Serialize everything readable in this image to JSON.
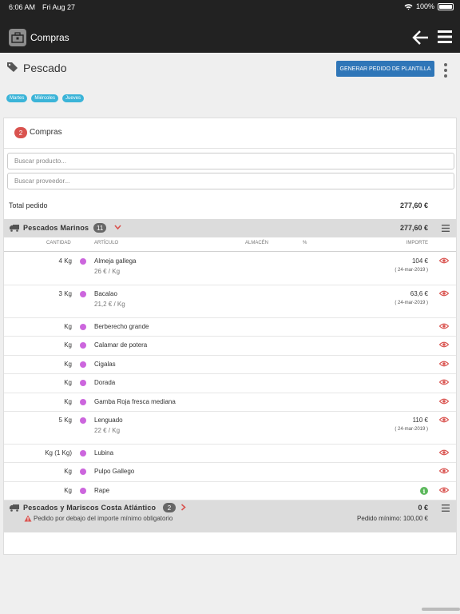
{
  "status_bar": {
    "time": "6:06 AM",
    "date": "Fri Aug 27",
    "battery": "100%"
  },
  "navbar": {
    "title": "Compras"
  },
  "header": {
    "title": "Pescado",
    "generate_button": "GENERAR PEDIDO DE PLANTILLA",
    "days": [
      "Martes",
      "Miércoles",
      "Jueves"
    ]
  },
  "card": {
    "count": "2",
    "title": "Compras",
    "search_product_placeholder": "Buscar producto...",
    "search_supplier_placeholder": "Buscar proveedor...",
    "total_label": "Total pedido",
    "total_value": "277,60 €"
  },
  "group1": {
    "name": "Pescados Marinos",
    "count": "11",
    "total": "277,60 €"
  },
  "columns": {
    "cantidad": "CANTIDAD",
    "articulo": "ARTÍCULO",
    "almacen": "ALMACÉN",
    "pct": "%",
    "importe": "IMPORTE"
  },
  "items": [
    {
      "qty": "4 Kg",
      "name": "Almeja gallega",
      "price": "26 € / Kg",
      "amount": "104 €",
      "date": "( 24-mar-2019 )"
    },
    {
      "qty": "3 Kg",
      "name": "Bacalao",
      "price": "21,2 € / Kg",
      "amount": "63,6 €",
      "date": "( 24-mar-2019 )"
    },
    {
      "qty": "Kg",
      "name": "Berberecho grande"
    },
    {
      "qty": "Kg",
      "name": "Calamar de potera"
    },
    {
      "qty": "Kg",
      "name": "Cigalas"
    },
    {
      "qty": "Kg",
      "name": "Dorada"
    },
    {
      "qty": "Kg",
      "name": "Gamba Roja fresca mediana"
    },
    {
      "qty": "5 Kg",
      "name": "Lenguado",
      "price": "22 € / Kg",
      "amount": "110 €",
      "date": "( 24-mar-2019 )"
    },
    {
      "qty": "Kg (1 Kg)",
      "name": "Lubina"
    },
    {
      "qty": "Kg",
      "name": "Pulpo Gallego"
    },
    {
      "qty": "Kg",
      "name": "Rape",
      "info": "i"
    }
  ],
  "group2": {
    "name": "Pescados y Mariscos Costa Atlántico",
    "count": "2",
    "total": "0 €",
    "warning": "Pedido por debajo del importe mínimo obligatorio",
    "min_order": "Pedido mínimo: 100,00 €"
  },
  "colors": {
    "bar": "#222222",
    "button": "#2f76b8",
    "pill": "#3bb4d8",
    "badge": "#d9534f",
    "dot": "#cc66dd",
    "eye": "#d9534f"
  }
}
